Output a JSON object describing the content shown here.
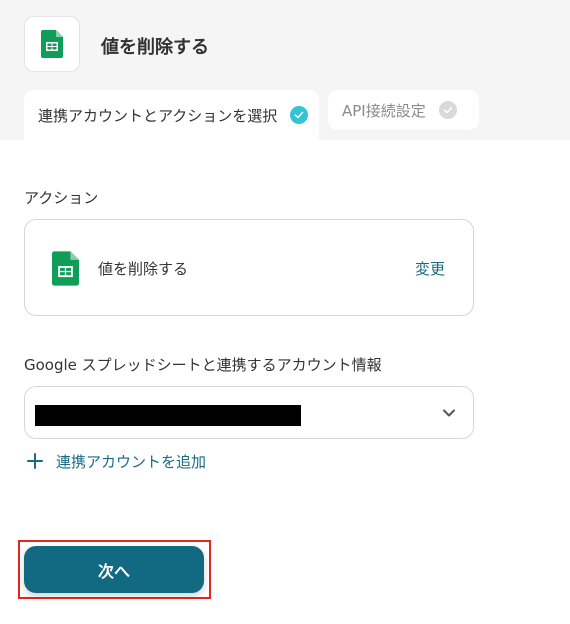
{
  "header": {
    "title": "値を削除する",
    "app_icon": "google-sheets-icon"
  },
  "tabs": [
    {
      "label": "連携アカウントとアクションを選択",
      "status": "complete",
      "check_color": "#33c2d6"
    },
    {
      "label": "API接続設定",
      "status": "pending",
      "check_color": "#d9d9d9"
    }
  ],
  "action_section": {
    "label": "アクション",
    "action_name": "値を削除する",
    "change_label": "変更",
    "app_icon": "google-sheets-icon"
  },
  "account_section": {
    "label": "Google スプレッドシートと連携するアカウント情報",
    "selected_value_redacted": true,
    "add_account_label": "連携アカウントを追加"
  },
  "footer": {
    "next_label": "次へ"
  },
  "colors": {
    "accent": "#126982",
    "link": "#186b85",
    "highlight_border": "#e0281e",
    "sheets_green": "#0f9d58"
  }
}
